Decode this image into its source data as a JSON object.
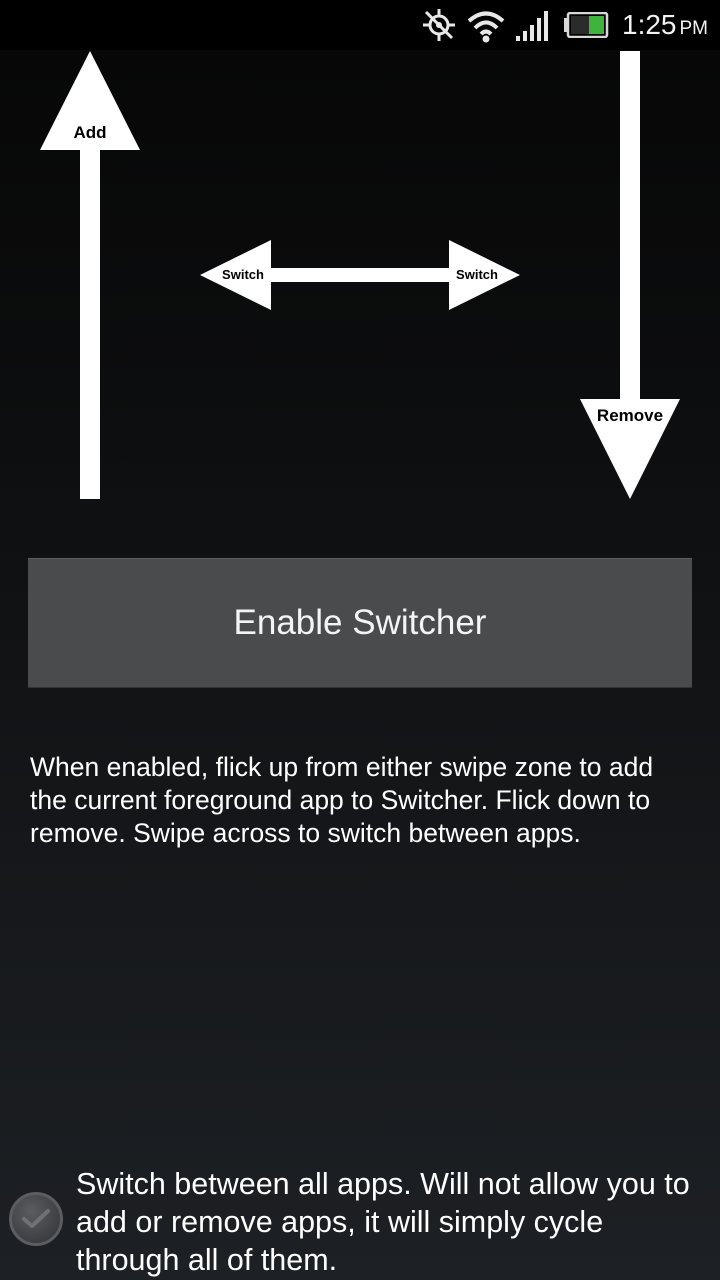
{
  "status_bar": {
    "time": "1:25",
    "ampm": "PM",
    "icons": [
      "gps-off-icon",
      "wifi-icon",
      "signal-icon",
      "battery-icon"
    ]
  },
  "diagram": {
    "up_label": "Add",
    "left_label": "Switch",
    "right_label": "Switch",
    "down_label": "Remove"
  },
  "enable_button": {
    "label": "Enable Switcher"
  },
  "description": "When enabled, flick up from either swipe zone to add the current foreground app to Switcher. Flick down to remove. Swipe across to switch between apps.",
  "option": {
    "text": "Switch between all apps. Will not allow you to add or remove apps, it will simply cycle through all of them.",
    "checked": false
  }
}
